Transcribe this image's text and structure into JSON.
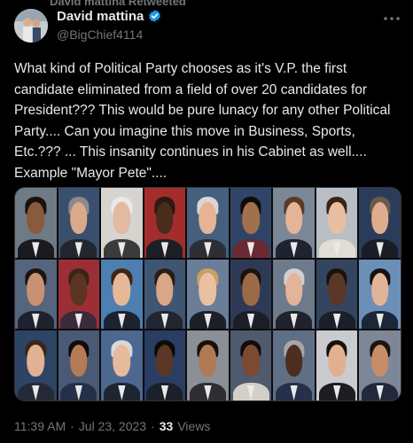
{
  "retweet": {
    "label": "David mattina Retweeted"
  },
  "author": {
    "display_name": "David mattina",
    "handle": "@BigChief4114",
    "verified": true,
    "verified_color": "#1d9bf0"
  },
  "more_icon": "more-dots-icon",
  "tweet": {
    "text": "What kind of Political Party chooses as it's V.P. the first candidate eliminated from a field of over 20 candidates for President??? This would be pure lunacy for any other Political Party.... Can you imagine this move in Business, Sports, Etc.??? ... This insanity continues in his Cabinet as well.... Example \"Mayor Pete\"...."
  },
  "meta": {
    "time": "11:39 AM",
    "separator": "·",
    "date": "Jul 23, 2023",
    "views_count": "33",
    "views_label": "Views"
  },
  "colors": {
    "background": "#000000",
    "text": "#e7e9ea",
    "muted": "#71767b",
    "accent": "#1d9bf0"
  },
  "photo_grid": {
    "portraits": [
      {
        "bg": "#6e7b86",
        "skin": "#8a5a3c",
        "hair": "#1a120d",
        "suit": "#1b1b1f"
      },
      {
        "bg": "#3a4f6e",
        "skin": "#d9a98a",
        "hair": "#8b8b8b",
        "suit": "#23262d"
      },
      {
        "bg": "#d7d4cf",
        "skin": "#e2b9a1",
        "hair": "#e8e8e8",
        "suit": "#3b3b3b"
      },
      {
        "bg": "#a32c2c",
        "skin": "#4a2b1c",
        "hair": "#2a1a12",
        "suit": "#1c1f26"
      },
      {
        "bg": "#45607e",
        "skin": "#e6b394",
        "hair": "#d7d7d7",
        "suit": "#2b2e35"
      },
      {
        "bg": "#2f4466",
        "skin": "#a1704c",
        "hair": "#0f0b09",
        "suit": "#6b2a33"
      },
      {
        "bg": "#7b8796",
        "skin": "#e3b596",
        "hair": "#5a3a24",
        "suit": "#1f2330"
      },
      {
        "bg": "#b9bec4",
        "skin": "#e8bfa3",
        "hair": "#3b2416",
        "suit": "#e0ddd6"
      },
      {
        "bg": "#2b3c5a",
        "skin": "#e0ad8c",
        "hair": "#6a5a48",
        "suit": "#1a1d25"
      },
      {
        "bg": "#55657d",
        "skin": "#c99172",
        "hair": "#1b1410",
        "suit": "#1e2230"
      },
      {
        "bg": "#9c2f36",
        "skin": "#5b3524",
        "hair": "#3a2418",
        "suit": "#3a2a3a"
      },
      {
        "bg": "#4d7fb0",
        "skin": "#e6b896",
        "hair": "#3b2719",
        "suit": "#1c2231"
      },
      {
        "bg": "#3f5673",
        "skin": "#d9a686",
        "hair": "#2a1d14",
        "suit": "#222631"
      },
      {
        "bg": "#6a7e99",
        "skin": "#ebc0a2",
        "hair": "#c9a064",
        "suit": "#1c1f28"
      },
      {
        "bg": "#2e3a55",
        "skin": "#9c6a49",
        "hair": "#1a120d",
        "suit": "#1b1e27"
      },
      {
        "bg": "#6d7a8c",
        "skin": "#e3b39a",
        "hair": "#d0d0d0",
        "suit": "#20232c"
      },
      {
        "bg": "#34465f",
        "skin": "#5a3828",
        "hair": "#1a110c",
        "suit": "#1b1f29"
      },
      {
        "bg": "#6c8fb8",
        "skin": "#e2b497",
        "hair": "#15110f",
        "suit": "#1b2638"
      },
      {
        "bg": "#2e4466",
        "skin": "#e0b293",
        "hair": "#3a2618",
        "suit": "#252a36"
      },
      {
        "bg": "#4a5a74",
        "skin": "#b57b56",
        "hair": "#0f0b09",
        "suit": "#24304a"
      },
      {
        "bg": "#4c6790",
        "skin": "#e6ba9d",
        "hair": "#d8d8d8",
        "suit": "#1f2431"
      },
      {
        "bg": "#2a3d62",
        "skin": "#5b3725",
        "hair": "#0e0a08",
        "suit": "#1c202b"
      },
      {
        "bg": "#8b8f96",
        "skin": "#b07a55",
        "hair": "#17110d",
        "suit": "#2d2d33"
      },
      {
        "bg": "#4f5a6d",
        "skin": "#7b4a32",
        "hair": "#110c09",
        "suit": "#d3cfc8"
      },
      {
        "bg": "#5f6f86",
        "skin": "#4b2e20",
        "hair": "#a7a7a7",
        "suit": "#26304a"
      },
      {
        "bg": "#c9cbcf",
        "skin": "#e1b18f",
        "hair": "#14100d",
        "suit": "#1d1d21"
      },
      {
        "bg": "#7d8797",
        "skin": "#c68d67",
        "hair": "#1b1511",
        "suit": "#23283a"
      }
    ]
  }
}
